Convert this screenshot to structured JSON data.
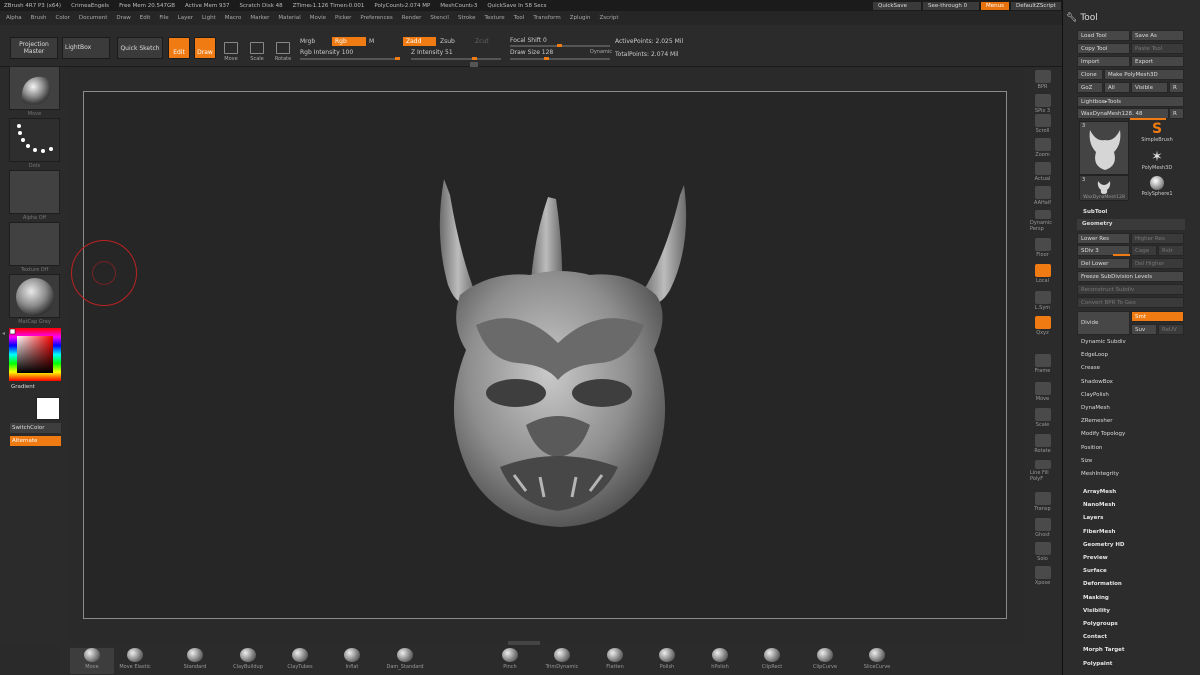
{
  "titlebar": {
    "app": "ZBrush 4R7 P3 (x64)",
    "user": "CrimeaEngels",
    "free_mem": "Free Mem 20.547GB",
    "active_mem": "Active Mem 937",
    "scratch": "Scratch Disk 48",
    "ztime": "ZTime▹1.126 Timer▹0.001",
    "polycount": "PolyCount▹2.074 MP",
    "meshcount": "MeshCount▹3",
    "quicksave_in": "QuickSave In 58 Secs",
    "quicksave": "QuickSave",
    "see_through": "See-through   0",
    "menus": "Menus",
    "default_zscript": "DefaultZScript"
  },
  "menubar": [
    "Alpha",
    "Brush",
    "Color",
    "Document",
    "Draw",
    "Edit",
    "File",
    "Layer",
    "Light",
    "Macro",
    "Marker",
    "Material",
    "Movie",
    "Picker",
    "Preferences",
    "Render",
    "Stencil",
    "Stroke",
    "Texture",
    "Tool",
    "Transform",
    "Zplugin",
    "Zscript"
  ],
  "toolbar": {
    "projection_master": "Projection Master",
    "lightbox": "LightBox",
    "quick_sketch": "Quick Sketch",
    "edit": "Edit",
    "draw": "Draw",
    "move": "Move",
    "scale": "Scale",
    "rotate": "Rotate",
    "mrgb": "Mrgb",
    "rgb": "Rgb",
    "m": "M",
    "zadd": "Zadd",
    "zsub": "Zsub",
    "zcut": "Zcut",
    "rgb_intensity": "Rgb Intensity 100",
    "z_intensity": "Z Intensity 51",
    "focal_shift": "Focal Shift 0",
    "draw_size": "Draw Size 128",
    "dynamic": "Dynamic",
    "active_points": "ActivePoints: 2.025 Mil",
    "total_points": "TotalPoints: 2.074 Mil"
  },
  "leftshelf": {
    "move": "Move",
    "dots": "Dots",
    "alpha_off": "Alpha Off",
    "texture_off": "Texture Off",
    "matcap": "MatCap Gray",
    "gradient": "Gradient",
    "switch_color": "SwitchColor",
    "alternate": "Alternate"
  },
  "rightshelf": [
    "BPR",
    "SPix 3",
    "Scroll",
    "Zoom",
    "Actual",
    "AAHalf",
    "Dynamic Persp",
    "Floor",
    "Local",
    "L.Sym",
    "Qxyz",
    "Frame",
    "Move",
    "Scale",
    "Rotate",
    "Line Fill PolyF",
    "Transp",
    "Ghost",
    "Solo",
    "Xpose"
  ],
  "palette": {
    "title": "Tool",
    "load_tool": "Load Tool",
    "save_as": "Save As",
    "copy_tool": "Copy Tool",
    "paste_tool": "Paste Tool",
    "import": "Import",
    "export": "Export",
    "clone": "Clone",
    "make_polymesh": "Make PolyMesh3D",
    "goz": "GoZ",
    "all": "All",
    "visible": "Visible",
    "r": "R",
    "lightbox_tools": "Lightbox▸Tools",
    "current_tool": "WaxDynaMesh128. 48",
    "thumb_count": "3",
    "thumbs": [
      "SimpleBrush",
      "PolyMesh3D",
      "WaxDynaMesh128",
      "PolySphere1"
    ],
    "subtool": "SubTool",
    "geometry": "Geometry",
    "lower_res": "Lower Res",
    "higher_res": "Higher Res",
    "sdiv": "SDiv 3",
    "cage": "Cage",
    "rstr": "Rstr",
    "del_lower": "Del Lower",
    "del_higher": "Del Higher",
    "freeze": "Freeze SubDivision Levels",
    "reconstruct": "Reconstruct Subdiv",
    "convert_bpr": "Convert BPR To Geo",
    "divide": "Divide",
    "smt": "Smt",
    "suv": "Suv",
    "reuv": "ReUV",
    "geo_items": [
      "Dynamic Subdiv",
      "EdgeLoop",
      "Crease",
      "ShadowBox",
      "ClayPolish",
      "DynaMesh",
      "ZRemesher",
      "Modify Topology",
      "Position",
      "Size",
      "MeshIntegrity"
    ],
    "sections": [
      "ArrayMesh",
      "NanoMesh",
      "Layers",
      "FiberMesh",
      "Geometry HD",
      "Preview",
      "Surface",
      "Deformation",
      "Masking",
      "Visibility",
      "Polygroups",
      "Contact",
      "Morph Target",
      "Polypaint"
    ]
  },
  "bottomshelf": [
    "Move",
    "Move Elastic",
    "Standard",
    "ClayBuildup",
    "ClayTubes",
    "Inflat",
    "Dam_Standard",
    "Pinch",
    "TrimDynamic",
    "Flatten",
    "Polish",
    "hPolish",
    "ClipRect",
    "ClipCurve",
    "SliceCurve"
  ],
  "colors": {
    "accent": "#ef7b12",
    "bg": "#2a2a2a"
  }
}
